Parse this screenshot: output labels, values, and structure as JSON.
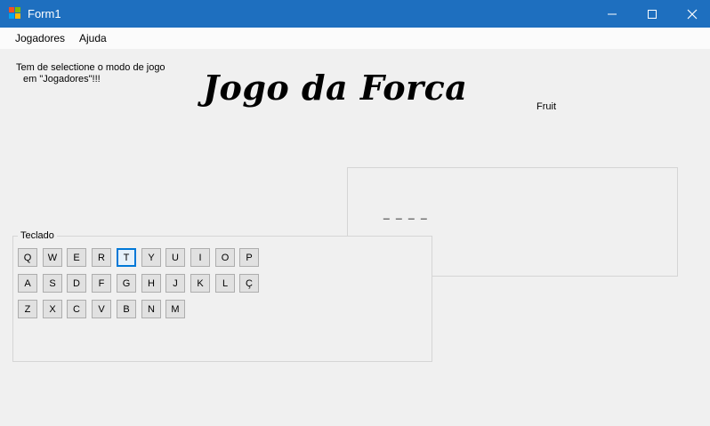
{
  "window": {
    "title": "Form1"
  },
  "menu": {
    "items": [
      {
        "label": "Jogadores"
      },
      {
        "label": "Ajuda"
      }
    ]
  },
  "status": {
    "line1": "Tem de selectione o modo de jogo",
    "line2": "em \"Jogadores\"!!!"
  },
  "game": {
    "title": "Jogo da Forca",
    "category": "Fruit",
    "word_mask": "_ _ _ _"
  },
  "keyboard": {
    "label": "Teclado",
    "focused_key": "T",
    "rows": [
      [
        "Q",
        "W",
        "E",
        "R",
        "T",
        "Y",
        "U",
        "I",
        "O",
        "P"
      ],
      [
        "A",
        "S",
        "D",
        "F",
        "G",
        "H",
        "J",
        "K",
        "L",
        "Ç"
      ],
      [
        "Z",
        "X",
        "C",
        "V",
        "B",
        "N",
        "M"
      ]
    ]
  },
  "colors": {
    "titlebar": "#1e6fbf",
    "focus_border": "#0078d7",
    "button_face": "#e1e1e1"
  }
}
